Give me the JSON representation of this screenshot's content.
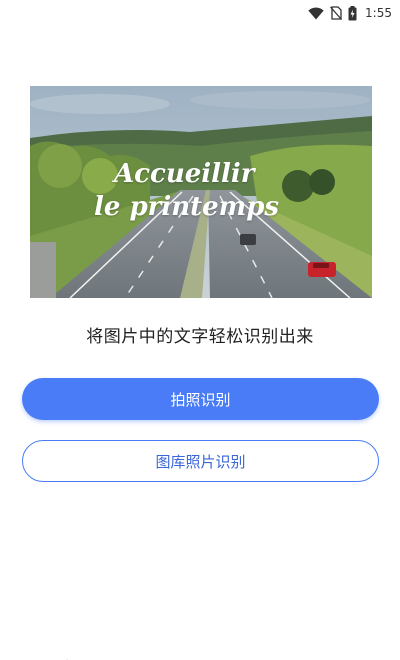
{
  "status_bar": {
    "time": "1:55",
    "icons": [
      "wifi-icon",
      "no-sim-icon",
      "battery-charging-icon"
    ]
  },
  "hero": {
    "line1": "Accueillir",
    "line2": "le printemps"
  },
  "subtitle": "将图片中的文字轻松识别出来",
  "buttons": {
    "photo_recognize": "拍照识别",
    "gallery_recognize": "图库照片识别"
  },
  "bottom_nav": {
    "icons": [
      "home-icon",
      "scan-icon",
      "profile-icon"
    ]
  },
  "colors": {
    "accent": "#4a7cf7",
    "background": "#ffffff"
  }
}
